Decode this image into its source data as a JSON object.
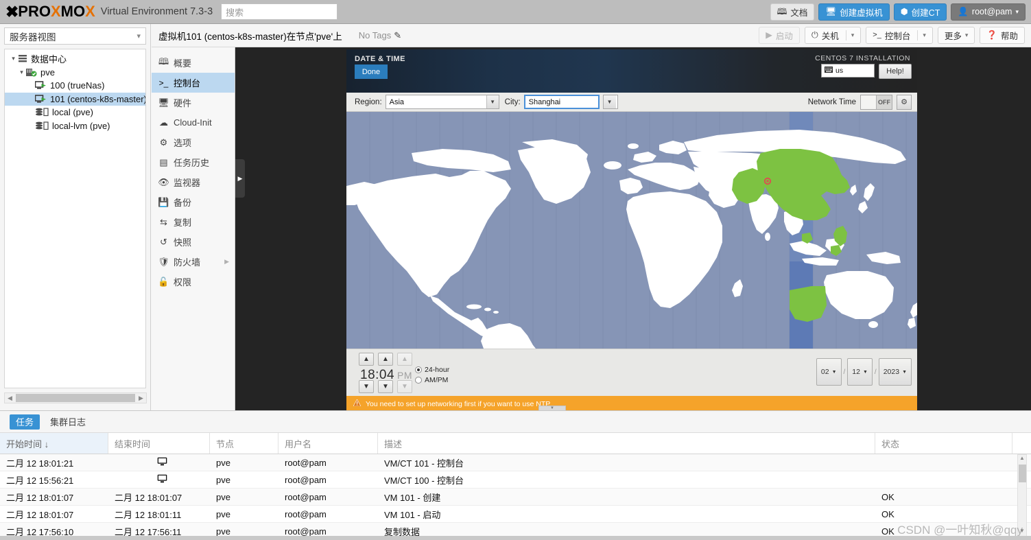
{
  "topbar": {
    "logo_x": "X",
    "logo_parts": [
      {
        "t": "P",
        "c": "d"
      },
      {
        "t": "R",
        "c": "d"
      },
      {
        "t": "O",
        "c": "d"
      },
      {
        "t": "X",
        "c": "o"
      },
      {
        "t": "M",
        "c": "d"
      },
      {
        "t": "O",
        "c": "d"
      },
      {
        "t": "X",
        "c": "o"
      }
    ],
    "product": "Virtual Environment 7.3-3",
    "search_placeholder": "搜索",
    "buttons": [
      {
        "label": "文档",
        "icon": "book-icon",
        "style": "light"
      },
      {
        "label": "创建虚拟机",
        "icon": "monitor-icon",
        "style": "blue"
      },
      {
        "label": "创建CT",
        "icon": "cube-icon",
        "style": "blue"
      },
      {
        "label": "root@pam",
        "icon": "user-icon",
        "style": "dark"
      }
    ]
  },
  "sidebar": {
    "view_label": "服务器视图",
    "tree": [
      {
        "label": "数据中心",
        "indent": 0,
        "icon": "datacenter-icon",
        "twist": "⌄",
        "selected": false
      },
      {
        "label": "pve",
        "indent": 1,
        "icon": "node-icon",
        "twist": "⌄",
        "selected": false
      },
      {
        "label": "100 (trueNas)",
        "indent": 2,
        "icon": "vm-running-icon",
        "twist": "",
        "selected": false
      },
      {
        "label": "101 (centos-k8s-master)",
        "indent": 2,
        "icon": "vm-running-icon",
        "twist": "",
        "selected": true
      },
      {
        "label": "local (pve)",
        "indent": 2,
        "icon": "storage-icon",
        "twist": "",
        "selected": false
      },
      {
        "label": "local-lvm (pve)",
        "indent": 2,
        "icon": "storage-icon",
        "twist": "",
        "selected": false
      }
    ]
  },
  "content_header": {
    "vm_title": "虚拟机101 (centos-k8s-master)在节点'pve'上",
    "tags_label": "No Tags",
    "actions": [
      {
        "label": "启动",
        "icon": "play-icon",
        "disabled": true,
        "split": false
      },
      {
        "label": "关机",
        "icon": "power-icon",
        "disabled": false,
        "split": true
      },
      {
        "label": "控制台",
        "icon": "terminal-icon",
        "disabled": false,
        "split": true
      },
      {
        "label": "更多",
        "icon": "",
        "disabled": false,
        "split": false,
        "caret": true
      },
      {
        "label": "帮助",
        "icon": "question-icon",
        "disabled": false,
        "split": false
      }
    ]
  },
  "vm_nav": [
    {
      "label": "概要",
      "icon": "book-icon",
      "selected": false,
      "arrow": false
    },
    {
      "label": "控制台",
      "icon": "terminal-icon",
      "selected": true,
      "arrow": false
    },
    {
      "label": "硬件",
      "icon": "monitor-icon",
      "selected": false,
      "arrow": false
    },
    {
      "label": "Cloud-Init",
      "icon": "cloud-icon",
      "selected": false,
      "arrow": false
    },
    {
      "label": "选项",
      "icon": "gear-icon",
      "selected": false,
      "arrow": false
    },
    {
      "label": "任务历史",
      "icon": "list-icon",
      "selected": false,
      "arrow": false
    },
    {
      "label": "监视器",
      "icon": "eye-icon",
      "selected": false,
      "arrow": false
    },
    {
      "label": "备份",
      "icon": "save-icon",
      "selected": false,
      "arrow": false
    },
    {
      "label": "复制",
      "icon": "replicate-icon",
      "selected": false,
      "arrow": false
    },
    {
      "label": "快照",
      "icon": "snapshot-icon",
      "selected": false,
      "arrow": false
    },
    {
      "label": "防火墙",
      "icon": "shield-icon",
      "selected": false,
      "arrow": true
    },
    {
      "label": "权限",
      "icon": "lock-icon",
      "selected": false,
      "arrow": false
    }
  ],
  "installer": {
    "screen_title": "DATE & TIME",
    "done_label": "Done",
    "product_title": "CENTOS 7 INSTALLATION",
    "keyboard_layout": "us",
    "help_label": "Help!",
    "region_label": "Region:",
    "region_value": "Asia",
    "city_label": "City:",
    "city_value": "Shanghai",
    "network_time_label": "Network Time",
    "network_time_state": "OFF",
    "clock_time": "18:04",
    "clock_meridiem": "PM",
    "format_24h": "24-hour",
    "format_ampm": "AM/PM",
    "format_selected": "24-hour",
    "date_month": "02",
    "date_day": "12",
    "date_year": "2023",
    "warning_text": "You need to set up networking first if you want to use NTP",
    "map_colors": {
      "ocean": "#8695b6",
      "land": "#ffffff",
      "highlight": "#7dc242",
      "selected_zone": "#6f88bb",
      "marker": "#d9534f"
    }
  },
  "bottom_panel": {
    "tabs": [
      {
        "label": "任务",
        "active": true
      },
      {
        "label": "集群日志",
        "active": false
      }
    ],
    "columns": [
      "开始时间 ↓",
      "结束时间",
      "节点",
      "用户名",
      "描述",
      "状态"
    ],
    "rows": [
      {
        "start": "二月 12 18:01:21",
        "end": "",
        "end_icon": "monitor-icon",
        "node": "pve",
        "user": "root@pam",
        "desc": "VM/CT 101 - 控制台",
        "status": ""
      },
      {
        "start": "二月 12 15:56:21",
        "end": "",
        "end_icon": "monitor-icon",
        "node": "pve",
        "user": "root@pam",
        "desc": "VM/CT 100 - 控制台",
        "status": ""
      },
      {
        "start": "二月 12 18:01:07",
        "end": "二月 12 18:01:07",
        "end_icon": "",
        "node": "pve",
        "user": "root@pam",
        "desc": "VM 101 - 创建",
        "status": "OK"
      },
      {
        "start": "二月 12 18:01:07",
        "end": "二月 12 18:01:11",
        "end_icon": "",
        "node": "pve",
        "user": "root@pam",
        "desc": "VM 101 - 启动",
        "status": "OK"
      },
      {
        "start": "二月 12 17:56:10",
        "end": "二月 12 17:56:11",
        "end_icon": "",
        "node": "pve",
        "user": "root@pam",
        "desc": "复制数据",
        "status": "OK"
      }
    ]
  },
  "watermark": "CSDN @一叶知秋@qqy"
}
